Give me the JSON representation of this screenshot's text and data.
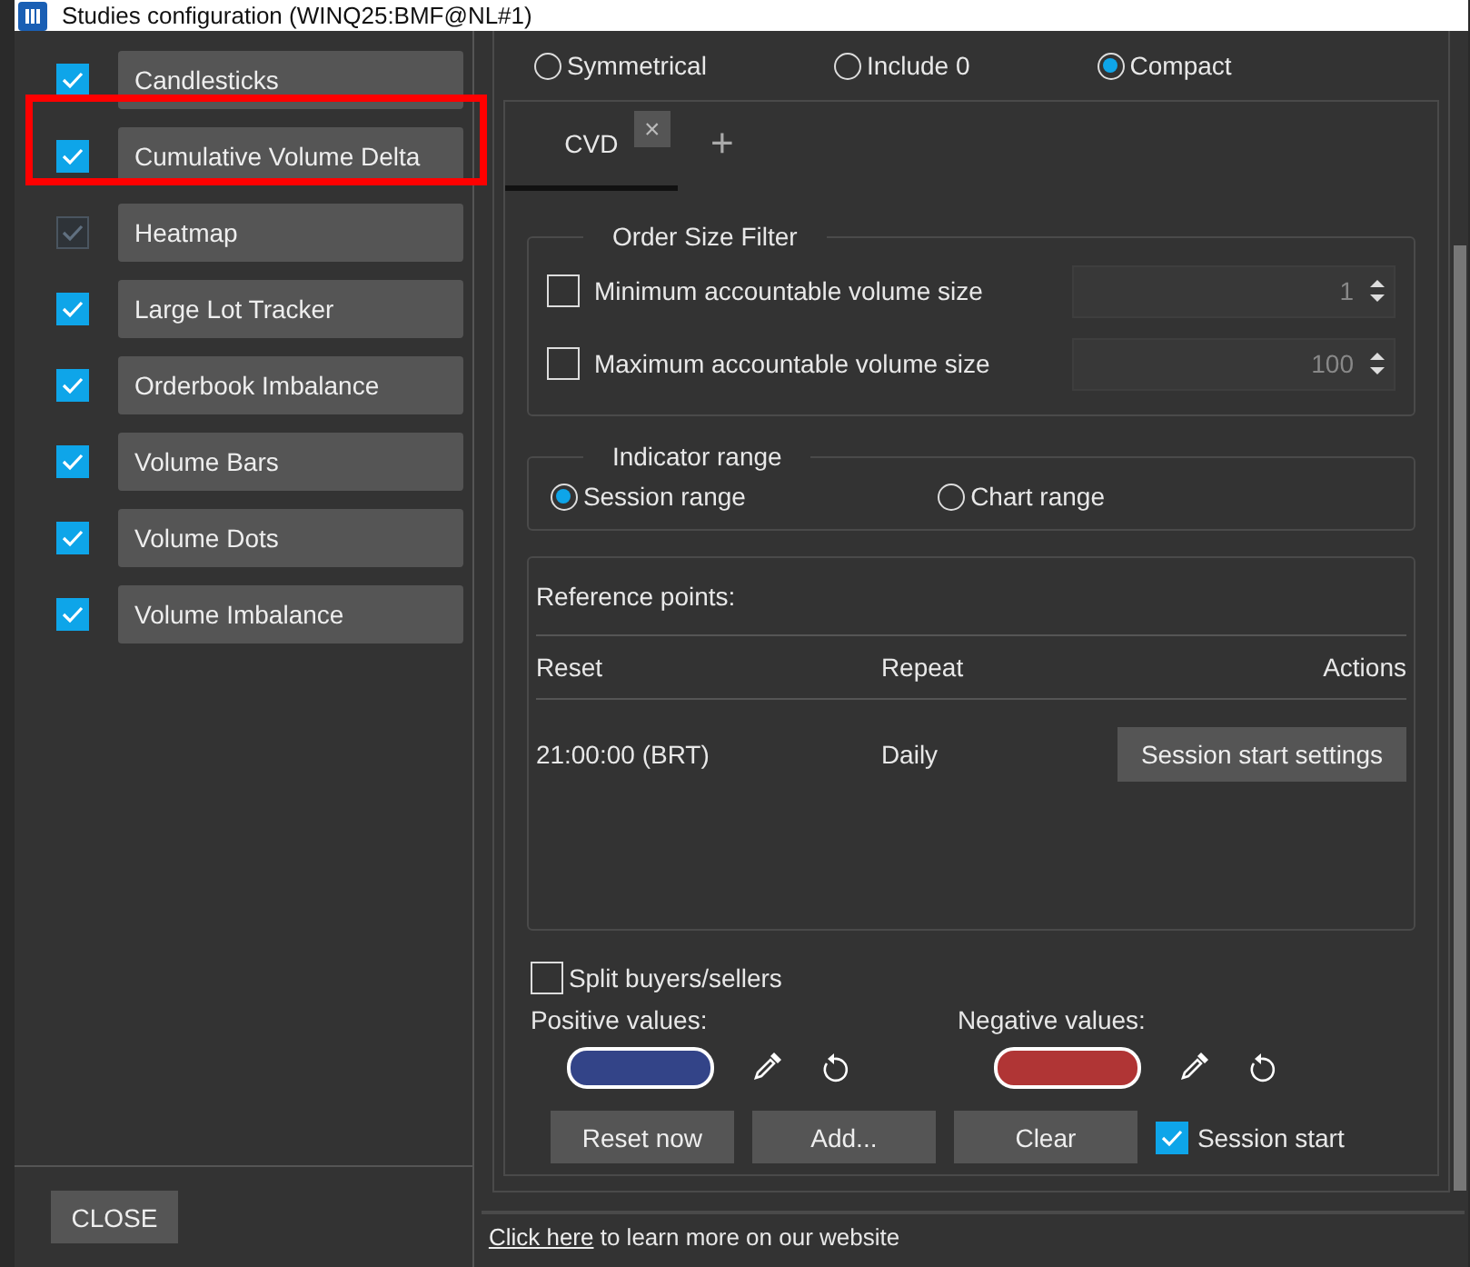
{
  "window": {
    "title": "Studies configuration (WINQ25:BMF@NL#1)"
  },
  "studies": [
    {
      "label": "Candlesticks",
      "checked": true,
      "disabled": false,
      "highlighted": false
    },
    {
      "label": "Cumulative Volume Delta",
      "checked": true,
      "disabled": false,
      "highlighted": true
    },
    {
      "label": "Heatmap",
      "checked": true,
      "disabled": true,
      "highlighted": false
    },
    {
      "label": "Large Lot Tracker",
      "checked": true,
      "disabled": false,
      "highlighted": false
    },
    {
      "label": "Orderbook Imbalance",
      "checked": true,
      "disabled": false,
      "highlighted": false
    },
    {
      "label": "Volume Bars",
      "checked": true,
      "disabled": false,
      "highlighted": false
    },
    {
      "label": "Volume Dots",
      "checked": true,
      "disabled": false,
      "highlighted": false
    },
    {
      "label": "Volume Imbalance",
      "checked": true,
      "disabled": false,
      "highlighted": false
    }
  ],
  "close_button": "CLOSE",
  "scale_modes": [
    {
      "label": "Symmetrical",
      "selected": false
    },
    {
      "label": "Include 0",
      "selected": false
    },
    {
      "label": "Compact",
      "selected": true
    }
  ],
  "tabs": [
    {
      "label": "CVD",
      "selected": true,
      "close": "×"
    }
  ],
  "add_tab": "+",
  "order_size_filter": {
    "title": "Order Size Filter",
    "rows": [
      {
        "label": "Minimum accountable volume size",
        "checked": false,
        "value": "1"
      },
      {
        "label": "Maximum accountable volume size",
        "checked": false,
        "value": "100"
      }
    ]
  },
  "indicator_range": {
    "title": "Indicator range",
    "options": [
      {
        "label": "Session range",
        "selected": true
      },
      {
        "label": "Chart range",
        "selected": false
      }
    ]
  },
  "reference_points": {
    "title": "Reference points:",
    "columns": [
      "Reset",
      "Repeat",
      "Actions"
    ],
    "rows": [
      {
        "reset": "21:00:00 (BRT)",
        "repeat": "Daily",
        "action": "Session start settings"
      }
    ]
  },
  "split": {
    "label": "Split buyers/sellers",
    "checked": false
  },
  "colors": [
    {
      "label": "Positive values:",
      "color": "#334488"
    },
    {
      "label": "Negative values:",
      "color": "#b03535"
    }
  ],
  "buttons": [
    "Reset now",
    "Add...",
    "Clear"
  ],
  "session_start": {
    "label": "Session start",
    "checked": true
  },
  "footer": {
    "link": "Click here",
    "text": " to learn more on our website"
  }
}
